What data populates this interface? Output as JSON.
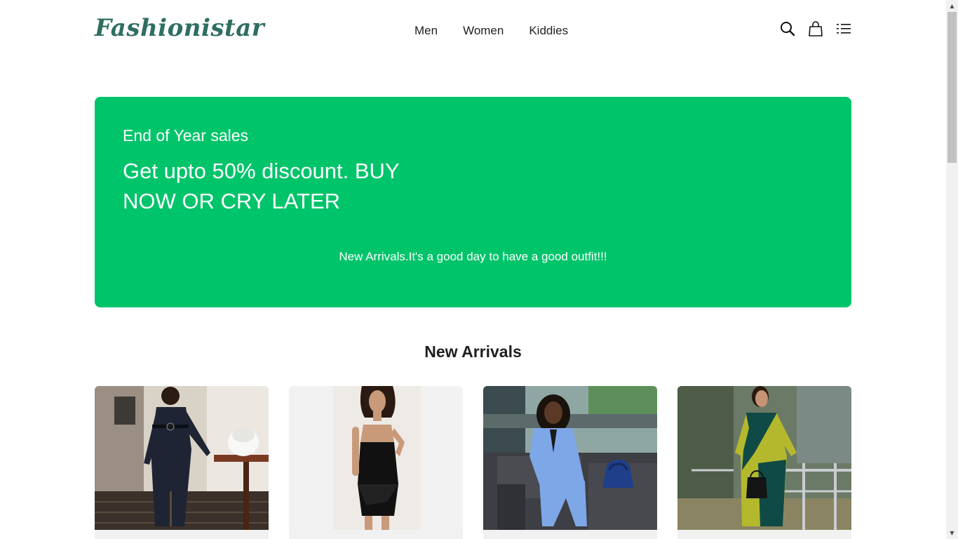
{
  "brand": {
    "logo": "Fashionistar"
  },
  "nav": {
    "items": [
      "Men",
      "Women",
      "Kiddies"
    ]
  },
  "icons": [
    "search-icon",
    "shopping-bag-icon",
    "menu-list-icon"
  ],
  "hero": {
    "subtitle": "End of Year sales",
    "title": "Get upto 50% discount. BUY NOW OR CRY LATER",
    "tagline": "New Arrivals.It's a good day to have a good outfit!!!"
  },
  "new_arrivals": {
    "title": "New Arrivals",
    "products": [
      {
        "image": "navy-belted-dress-photo"
      },
      {
        "image": "black-satin-mini-dress-photo"
      },
      {
        "image": "blue-pantsuit-photo"
      },
      {
        "image": "green-print-dress-photo"
      }
    ]
  },
  "colors": {
    "brand": "#2e6e61",
    "hero_bg": "#00c46a"
  }
}
